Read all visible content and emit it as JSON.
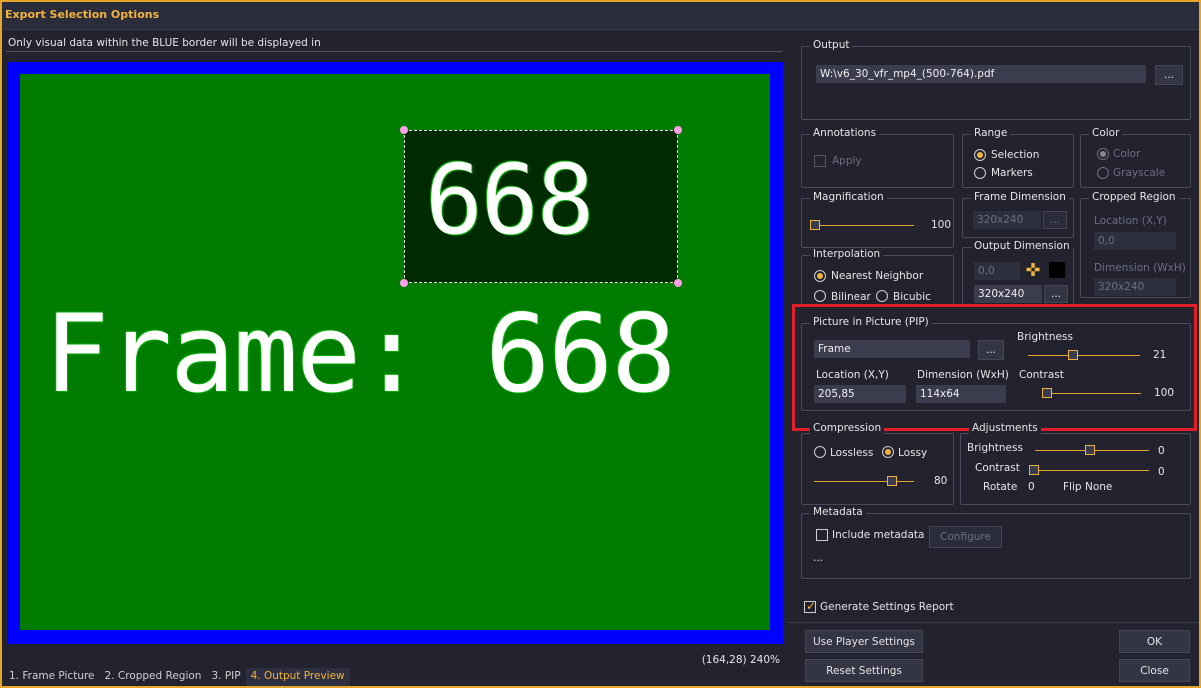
{
  "window": {
    "title": "Export Selection Options"
  },
  "preview": {
    "notice": "Only visual data within the BLUE border will be displayed in",
    "pip_text": "668",
    "frame_text": "Frame: 668",
    "coord": "(164,28) 240%",
    "tabs": [
      "1. Frame Picture",
      "2. Cropped Region",
      "3. PIP",
      "4. Output Preview"
    ],
    "active_tab": 3
  },
  "output": {
    "title": "Output",
    "path": "W:\\v6_30_vfr_mp4_(500-764).pdf",
    "browse": "..."
  },
  "annotations": {
    "title": "Annotations",
    "apply": "Apply"
  },
  "range": {
    "title": "Range",
    "selection": "Selection",
    "markers": "Markers"
  },
  "color": {
    "title": "Color",
    "color": "Color",
    "grayscale": "Grayscale"
  },
  "magnification": {
    "title": "Magnification",
    "value": "100",
    "level": 0
  },
  "frame_dimension": {
    "title": "Frame Dimension",
    "value": "320x240",
    "browse": "..."
  },
  "cropped_region": {
    "title": "Cropped Region",
    "location_label": "Location (X,Y)",
    "location": "0,0",
    "dimension_label": "Dimension (WxH)",
    "dimension": "320x240"
  },
  "interpolation": {
    "title": "Interpolation",
    "nearest": "Nearest Neighbor",
    "bilinear": "Bilinear",
    "bicubic": "Bicubic"
  },
  "output_dimension": {
    "title": "Output Dimension",
    "location": "0,0",
    "dimension": "320x240",
    "browse": "..."
  },
  "pip": {
    "title": "Picture in Picture (PIP)",
    "source": "Frame",
    "browse": "...",
    "location_label": "Location (X,Y)",
    "location": "205,85",
    "dimension_label": "Dimension (WxH)",
    "dimension": "114x64",
    "brightness_label": "Brightness",
    "brightness": "21",
    "brightness_level": 0.21,
    "contrast_label": "Contrast",
    "contrast": "100",
    "contrast_level": 0
  },
  "compression": {
    "title": "Compression",
    "lossless": "Lossless",
    "lossy": "Lossy",
    "value": "80",
    "level": 0.8
  },
  "adjustments": {
    "title": "Adjustments",
    "brightness_label": "Brightness",
    "brightness": "0",
    "contrast_label": "Contrast",
    "contrast": "0",
    "rotate_label": "Rotate",
    "rotate": "0",
    "flip_label": "Flip",
    "flip": "None"
  },
  "metadata": {
    "title": "Metadata",
    "include": "Include metadata",
    "configure": "Configure",
    "more": "..."
  },
  "report": {
    "label": "Generate Settings Report"
  },
  "buttons": {
    "use_player": "Use Player Settings",
    "reset": "Reset Settings",
    "ok": "OK",
    "close": "Close"
  },
  "colors": {
    "accent": "#f0b43c",
    "highlight": "#e3202a",
    "preview_border": "#0000ff",
    "preview_bg": "#007d00"
  }
}
